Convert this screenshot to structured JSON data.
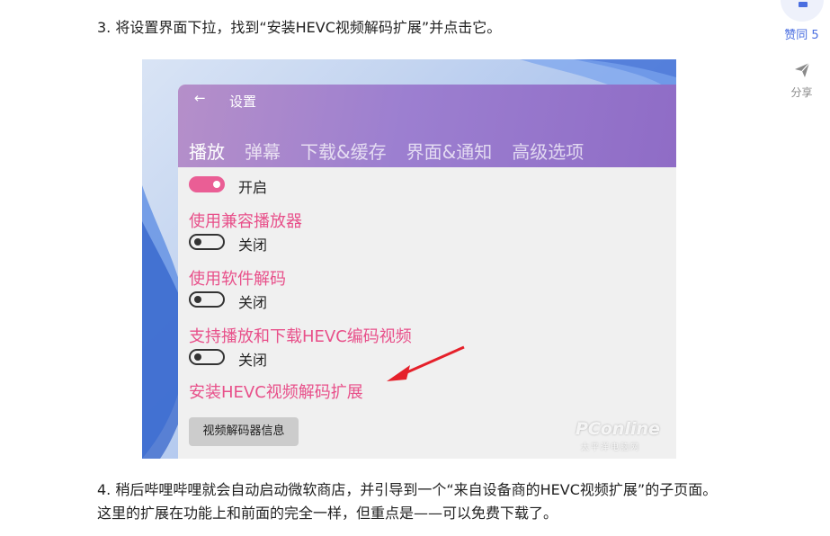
{
  "article": {
    "step3": "3. 将设置界面下拉，找到“安装HEVC视频解码扩展”并点击它。",
    "step4": "4. 稍后哔哩哔哩就会自动启动微软商店，并引导到一个“来自设备商的HEVC视频扩展”的子页面。这里的扩展在功能上和前面的完全一样，但重点是——可以免费下载了。"
  },
  "rail": {
    "like_label": "赞同 5",
    "like_icon": "thumbs-up-icon",
    "share_label": "分享",
    "share_icon": "paper-plane-icon",
    "accent_color": "#4a6ee0"
  },
  "screenshot": {
    "back_icon": "←",
    "window_title": "设置",
    "tabs": [
      "播放",
      "弹幕",
      "下载&缓存",
      "界面&通知",
      "高级选项"
    ],
    "active_tab": "播放",
    "settings": [
      {
        "title": "",
        "state": "开启",
        "on": true
      },
      {
        "title": "使用兼容播放器",
        "state": "关闭",
        "on": false
      },
      {
        "title": "使用软件解码",
        "state": "关闭",
        "on": false
      },
      {
        "title": "支持播放和下载HEVC编码视频",
        "state": "关闭",
        "on": false
      }
    ],
    "install_link": "安装HEVC视频解码扩展",
    "codec_info_button": "视频解码器信息",
    "watermark": "PConline",
    "watermark_sub": "太平洋电脑网",
    "accent_pink": "#e8508a",
    "header_purple": "#9c7fd0"
  }
}
